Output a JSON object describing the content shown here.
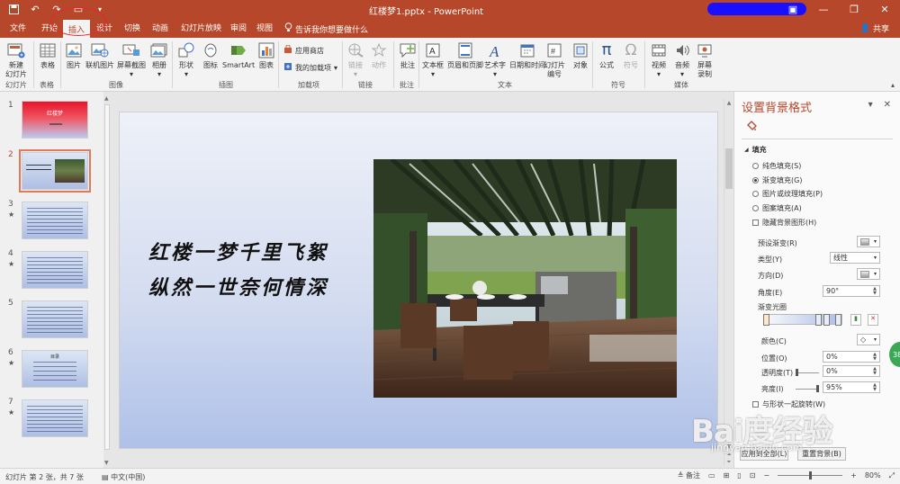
{
  "window": {
    "title": "红楼梦1.pptx - PowerPoint",
    "controls": [
      "minimize",
      "restore",
      "close"
    ]
  },
  "ribbon_tabs": [
    {
      "label": "文件"
    },
    {
      "label": "开始"
    },
    {
      "label": "插入"
    },
    {
      "label": "设计"
    },
    {
      "label": "切换"
    },
    {
      "label": "动画"
    },
    {
      "label": "幻灯片放映"
    },
    {
      "label": "审阅"
    },
    {
      "label": "视图"
    }
  ],
  "active_tab": "插入",
  "tell_me": "告诉我你想要做什么",
  "share": "共享",
  "ribbon": {
    "new_slide_1": "新建",
    "new_slide_2": "幻灯片",
    "table": "表格",
    "picture": "图片",
    "online_picture": "联机图片",
    "screenshot": "屏幕截图",
    "album": "相册",
    "shapes": "形状",
    "icons": "图标",
    "smartart": "SmartArt",
    "chart": "图表",
    "store": "应用商店",
    "my_addins": "我的加载项",
    "link": "链接",
    "action": "动作",
    "comment": "批注",
    "textbox": "文本框",
    "header_footer": "页眉和页脚",
    "wordart": "艺术字",
    "datetime": "日期和时间",
    "slide_number_1": "幻灯片",
    "slide_number_2": "编号",
    "object": "对象",
    "equation": "公式",
    "symbol": "符号",
    "video": "视频",
    "audio": "音频",
    "screen_record_1": "屏幕",
    "screen_record_2": "录制",
    "groups": {
      "slides": "幻灯片",
      "tables": "表格",
      "images": "图像",
      "illustrations": "插图",
      "addins": "加载项",
      "links": "链接",
      "comments": "批注",
      "text": "文本",
      "symbols": "符号",
      "media": "媒体"
    }
  },
  "slides": [
    {
      "num": "1",
      "star": "",
      "title": "红楼梦"
    },
    {
      "num": "2",
      "star": "",
      "title": ""
    },
    {
      "num": "3",
      "star": "★",
      "title": ""
    },
    {
      "num": "4",
      "star": "★",
      "title": ""
    },
    {
      "num": "5",
      "star": "",
      "title": ""
    },
    {
      "num": "6",
      "star": "★",
      "title": "目录"
    },
    {
      "num": "7",
      "star": "★",
      "title": ""
    }
  ],
  "current_slide": {
    "line1": "红楼一梦千里飞絮",
    "line2": "纵然一世奈何情深"
  },
  "format_pane": {
    "title": "设置背景格式",
    "section": "填充",
    "options": {
      "solid": "纯色填充(S)",
      "gradient": "渐变填充(G)",
      "picture": "图片或纹理填充(P)",
      "pattern": "图案填充(A)",
      "hide_bg": "隐藏背景图形(H)"
    },
    "preset_label": "预设渐变(R)",
    "type_label": "类型(Y)",
    "type_value": "线性",
    "direction_label": "方向(D)",
    "angle_label": "角度(E)",
    "angle_value": "90°",
    "stops_label": "渐变光圈",
    "color_label": "颜色(C)",
    "position_label": "位置(O)",
    "position_value": "0%",
    "transparency_label": "透明度(T)",
    "transparency_value": "0%",
    "brightness_label": "亮度(I)",
    "brightness_value": "95%",
    "rotate_label": "与形状一起旋转(W)",
    "apply_all": "应用到全部(L)",
    "reset": "重置背景(B)"
  },
  "status": {
    "slide_info": "幻灯片 第 2 张，共 7 张",
    "language": "中文(中国)",
    "notes": "备注",
    "zoom": "80%",
    "zoom_fraction": 0.5
  },
  "overlays": {
    "badge": "38",
    "watermark": "Bai度经验",
    "watermark_sub": "jingyan.baidu.com"
  },
  "colors": {
    "accent": "#b7472a",
    "slide_gradient_top": "#eef1f8",
    "slide_gradient_bottom": "#afc1e8"
  }
}
